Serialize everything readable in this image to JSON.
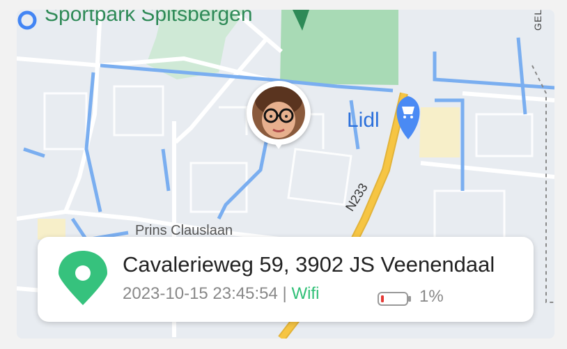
{
  "map": {
    "labels": {
      "sportpark": "Sportpark Spitsbergen",
      "lidl": "Lidl",
      "street": "Prins Clauslaan",
      "road_number": "N233",
      "gelderland": "GELDERLAND"
    },
    "colors": {
      "park": "#a8dab5",
      "water": "#7aaef0",
      "road_major": "#f6c543",
      "road_minor": "#ffffff",
      "poi_green": "#2e8a57",
      "poi_blue": "#2a6fdb"
    },
    "icons": {
      "shopping": "shopping-cart-pin-icon",
      "park": "park-pin-icon"
    }
  },
  "device": {
    "avatar": "avatar-photo"
  },
  "location_card": {
    "address": "Cavalerieweg 59, 3902 JS Veenendaal",
    "timestamp": "2023-10-15 23:45:54",
    "separator": "|",
    "connection": "Wifi",
    "battery_percent": "1%",
    "battery_level": 0.01,
    "colors": {
      "pin": "#36c27d",
      "connection": "#2fbf76",
      "battery_low": "#e53935"
    }
  }
}
